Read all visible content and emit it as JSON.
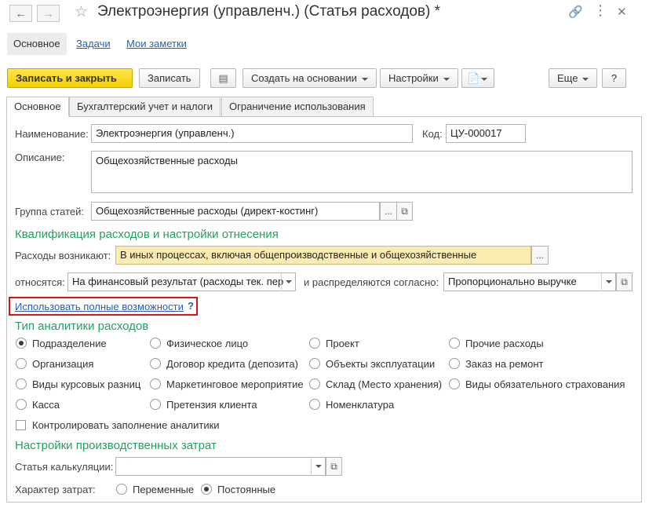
{
  "window": {
    "title": "Электроэнергия (управленч.) (Статья расходов)",
    "modified_mark": "*",
    "nav_back_icon": "arrow-left-icon",
    "nav_forward_icon": "arrow-right-icon"
  },
  "top_tabs": [
    {
      "label": "Основное"
    },
    {
      "label": "Задачи"
    },
    {
      "label": "Мои заметки"
    }
  ],
  "toolbar": {
    "save_close": "Записать и закрыть",
    "save": "Записать",
    "create_based": "Создать на основании",
    "settings": "Настройки",
    "more": "Еще",
    "help": "?"
  },
  "form_tabs": [
    {
      "label": "Основное"
    },
    {
      "label": "Бухгалтерский учет и налоги"
    },
    {
      "label": "Ограничение использования"
    }
  ],
  "form": {
    "name_label": "Наименование:",
    "name_value": "Электроэнергия (управленч.)",
    "code_label": "Код:",
    "code_value": "ЦУ-000017",
    "description_label": "Описание:",
    "description_value": "Общехозяйственные расходы",
    "group_label": "Группа статей:",
    "group_value": "Общехозяйственные расходы (директ-костинг)",
    "ellipsis": "...",
    "section_qualification": "Квалификация расходов и настройки отнесения",
    "arise_label": "Расходы возникают:",
    "arise_value": "В иных процессах, включая общепроизводственные и общехозяйственные",
    "relates_label": "относятся:",
    "relates_value": "На финансовый результат (расходы тек. пер",
    "distributed_label": "и распределяются согласно:",
    "distributed_value": "Пропорционально выручке",
    "full_features_link": "Использовать полные возможности",
    "help_mark": "?",
    "section_analytics": "Тип аналитики расходов",
    "analytics_options": [
      {
        "label": "Подразделение",
        "selected": true
      },
      {
        "label": "Физическое лицо",
        "selected": false
      },
      {
        "label": "Проект",
        "selected": false
      },
      {
        "label": "Прочие расходы",
        "selected": false
      },
      {
        "label": "Организация",
        "selected": false
      },
      {
        "label": "Договор кредита (депозита)",
        "selected": false
      },
      {
        "label": "Объекты эксплуатации",
        "selected": false
      },
      {
        "label": "Заказ на ремонт",
        "selected": false
      },
      {
        "label": "Виды курсовых разниц",
        "selected": false
      },
      {
        "label": "Маркетинговое мероприятие",
        "selected": false
      },
      {
        "label": "Склад (Место хранения)",
        "selected": false
      },
      {
        "label": "Виды обязательного страхования",
        "selected": false
      },
      {
        "label": "Касса",
        "selected": false
      },
      {
        "label": "Претензия клиента",
        "selected": false
      },
      {
        "label": "Номенклатура",
        "selected": false
      }
    ],
    "control_fill_label": "Контролировать заполнение аналитики",
    "control_fill_checked": false,
    "section_production": "Настройки производственных затрат",
    "calc_item_label": "Статья калькуляции:",
    "calc_item_value": "",
    "cost_nature_label": "Характер затрат:",
    "cost_nature_options": [
      {
        "label": "Переменные",
        "selected": false
      },
      {
        "label": "Постоянные",
        "selected": true
      }
    ]
  },
  "colors": {
    "section_green": "#26a05e",
    "primary_button": "#f4cf00",
    "link_blue": "#2a5fb0",
    "highlight_red": "#e01010",
    "yellow_field": "#fcebb0"
  }
}
